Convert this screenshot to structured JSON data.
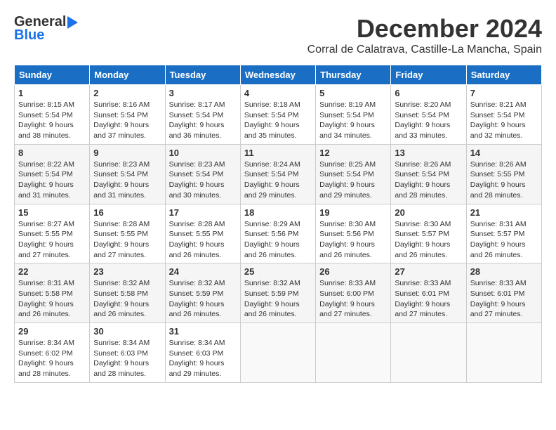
{
  "header": {
    "logo_general": "General",
    "logo_blue": "Blue",
    "month_title": "December 2024",
    "location": "Corral de Calatrava, Castille-La Mancha, Spain"
  },
  "weekdays": [
    "Sunday",
    "Monday",
    "Tuesday",
    "Wednesday",
    "Thursday",
    "Friday",
    "Saturday"
  ],
  "weeks": [
    [
      {
        "day": "1",
        "sunrise": "8:15 AM",
        "sunset": "5:54 PM",
        "daylight": "9 hours and 38 minutes."
      },
      {
        "day": "2",
        "sunrise": "8:16 AM",
        "sunset": "5:54 PM",
        "daylight": "9 hours and 37 minutes."
      },
      {
        "day": "3",
        "sunrise": "8:17 AM",
        "sunset": "5:54 PM",
        "daylight": "9 hours and 36 minutes."
      },
      {
        "day": "4",
        "sunrise": "8:18 AM",
        "sunset": "5:54 PM",
        "daylight": "9 hours and 35 minutes."
      },
      {
        "day": "5",
        "sunrise": "8:19 AM",
        "sunset": "5:54 PM",
        "daylight": "9 hours and 34 minutes."
      },
      {
        "day": "6",
        "sunrise": "8:20 AM",
        "sunset": "5:54 PM",
        "daylight": "9 hours and 33 minutes."
      },
      {
        "day": "7",
        "sunrise": "8:21 AM",
        "sunset": "5:54 PM",
        "daylight": "9 hours and 32 minutes."
      }
    ],
    [
      {
        "day": "8",
        "sunrise": "8:22 AM",
        "sunset": "5:54 PM",
        "daylight": "9 hours and 31 minutes."
      },
      {
        "day": "9",
        "sunrise": "8:23 AM",
        "sunset": "5:54 PM",
        "daylight": "9 hours and 31 minutes."
      },
      {
        "day": "10",
        "sunrise": "8:23 AM",
        "sunset": "5:54 PM",
        "daylight": "9 hours and 30 minutes."
      },
      {
        "day": "11",
        "sunrise": "8:24 AM",
        "sunset": "5:54 PM",
        "daylight": "9 hours and 29 minutes."
      },
      {
        "day": "12",
        "sunrise": "8:25 AM",
        "sunset": "5:54 PM",
        "daylight": "9 hours and 29 minutes."
      },
      {
        "day": "13",
        "sunrise": "8:26 AM",
        "sunset": "5:54 PM",
        "daylight": "9 hours and 28 minutes."
      },
      {
        "day": "14",
        "sunrise": "8:26 AM",
        "sunset": "5:55 PM",
        "daylight": "9 hours and 28 minutes."
      }
    ],
    [
      {
        "day": "15",
        "sunrise": "8:27 AM",
        "sunset": "5:55 PM",
        "daylight": "9 hours and 27 minutes."
      },
      {
        "day": "16",
        "sunrise": "8:28 AM",
        "sunset": "5:55 PM",
        "daylight": "9 hours and 27 minutes."
      },
      {
        "day": "17",
        "sunrise": "8:28 AM",
        "sunset": "5:55 PM",
        "daylight": "9 hours and 26 minutes."
      },
      {
        "day": "18",
        "sunrise": "8:29 AM",
        "sunset": "5:56 PM",
        "daylight": "9 hours and 26 minutes."
      },
      {
        "day": "19",
        "sunrise": "8:30 AM",
        "sunset": "5:56 PM",
        "daylight": "9 hours and 26 minutes."
      },
      {
        "day": "20",
        "sunrise": "8:30 AM",
        "sunset": "5:57 PM",
        "daylight": "9 hours and 26 minutes."
      },
      {
        "day": "21",
        "sunrise": "8:31 AM",
        "sunset": "5:57 PM",
        "daylight": "9 hours and 26 minutes."
      }
    ],
    [
      {
        "day": "22",
        "sunrise": "8:31 AM",
        "sunset": "5:58 PM",
        "daylight": "9 hours and 26 minutes."
      },
      {
        "day": "23",
        "sunrise": "8:32 AM",
        "sunset": "5:58 PM",
        "daylight": "9 hours and 26 minutes."
      },
      {
        "day": "24",
        "sunrise": "8:32 AM",
        "sunset": "5:59 PM",
        "daylight": "9 hours and 26 minutes."
      },
      {
        "day": "25",
        "sunrise": "8:32 AM",
        "sunset": "5:59 PM",
        "daylight": "9 hours and 26 minutes."
      },
      {
        "day": "26",
        "sunrise": "8:33 AM",
        "sunset": "6:00 PM",
        "daylight": "9 hours and 27 minutes."
      },
      {
        "day": "27",
        "sunrise": "8:33 AM",
        "sunset": "6:01 PM",
        "daylight": "9 hours and 27 minutes."
      },
      {
        "day": "28",
        "sunrise": "8:33 AM",
        "sunset": "6:01 PM",
        "daylight": "9 hours and 27 minutes."
      }
    ],
    [
      {
        "day": "29",
        "sunrise": "8:34 AM",
        "sunset": "6:02 PM",
        "daylight": "9 hours and 28 minutes."
      },
      {
        "day": "30",
        "sunrise": "8:34 AM",
        "sunset": "6:03 PM",
        "daylight": "9 hours and 28 minutes."
      },
      {
        "day": "31",
        "sunrise": "8:34 AM",
        "sunset": "6:03 PM",
        "daylight": "9 hours and 29 minutes."
      },
      null,
      null,
      null,
      null
    ]
  ]
}
